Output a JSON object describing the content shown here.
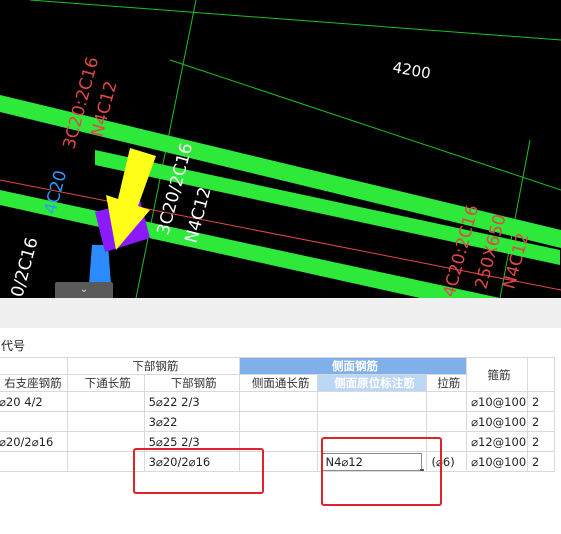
{
  "cad": {
    "dimension": "4200",
    "labels": [
      "3C20:2C16",
      "N4C12",
      "3C20/2C16",
      "N4C12",
      "4C20",
      "0/2C16",
      "4C20:2C16",
      "250X650",
      "N4C12"
    ],
    "collapse_tab": "⌄"
  },
  "panel": {
    "code_label": "代号",
    "header": {
      "lower_group": "下部钢筋",
      "side_group": "侧面钢筋",
      "stirrup": "箍筋",
      "col_right_support": "右支座钢筋",
      "col_lower_through": "下通长筋",
      "col_lower": "下部钢筋",
      "col_side_through": "侧面通长筋",
      "col_side_annot": "侧面原位标注筋",
      "col_tie": "拉筋"
    },
    "rows": [
      {
        "right_support": "⌀20 4/2",
        "lower_through": "",
        "lower": "5⌀22 2/3",
        "side_through": "",
        "side_annot": "",
        "tie": "",
        "stirrup": "⌀10@100",
        "last": "2"
      },
      {
        "right_support": "",
        "lower_through": "",
        "lower": "3⌀22",
        "side_through": "",
        "side_annot": "",
        "tie": "",
        "stirrup": "⌀10@100",
        "last": "2"
      },
      {
        "right_support": "⌀20/2⌀16",
        "lower_through": "",
        "lower": "5⌀25 2/3",
        "side_through": "",
        "side_annot": "",
        "tie": "",
        "stirrup": "⌀12@100",
        "last": "2"
      },
      {
        "right_support": "",
        "lower_through": "",
        "lower": "3⌀20/2⌀16",
        "side_through": "",
        "side_annot": "N4⌀12",
        "tie": "(⌀6)",
        "stirrup": "⌀10@100",
        "last": "2"
      }
    ]
  },
  "colors": {
    "cad_bg": "#000000",
    "beam_green": "#2ee83a",
    "label_red": "#e04848",
    "header_blue": "#7fb0ea",
    "highlight_red": "#e0222b",
    "arrow_yellow": "#ffff1a",
    "marker_purple": "#8c1aff",
    "column_blue": "#2b8cff"
  }
}
